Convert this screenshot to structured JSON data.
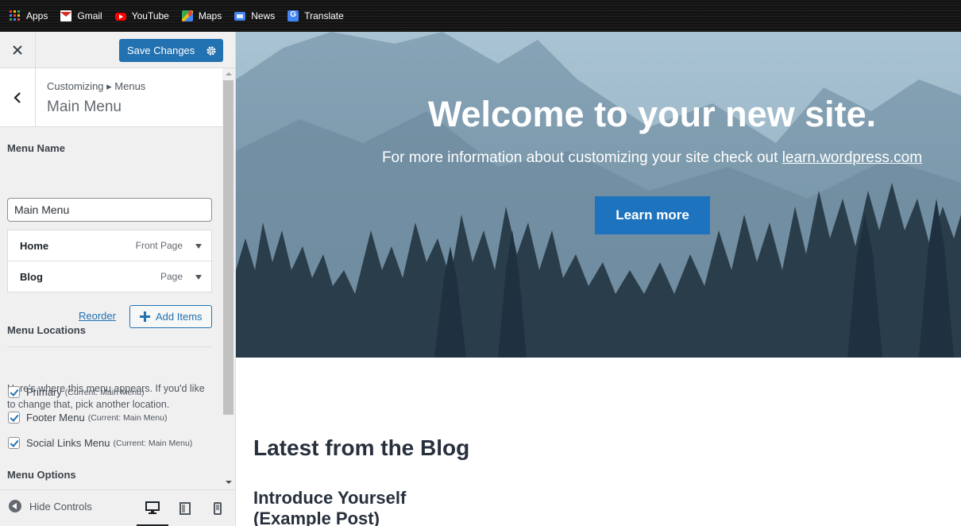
{
  "bookmarks": [
    {
      "label": "Apps",
      "icon": "apps-grid-icon"
    },
    {
      "label": "Gmail",
      "icon": "gmail-icon"
    },
    {
      "label": "YouTube",
      "icon": "youtube-icon"
    },
    {
      "label": "Maps",
      "icon": "maps-icon"
    },
    {
      "label": "News",
      "icon": "news-icon"
    },
    {
      "label": "Translate",
      "icon": "translate-icon"
    }
  ],
  "header": {
    "save_label": "Save Changes"
  },
  "section": {
    "breadcrumb": "Customizing ▸ Menus",
    "title": "Main Menu"
  },
  "menu_name": {
    "label": "Menu Name",
    "value": "Main Menu"
  },
  "menu_items": [
    {
      "title": "Home",
      "type": "Front Page"
    },
    {
      "title": "Blog",
      "type": "Page"
    }
  ],
  "actions": {
    "reorder": "Reorder",
    "add_items": "Add Items"
  },
  "locations": {
    "heading": "Menu Locations",
    "description": "Here's where this menu appears. If you'd like to change that, pick another location.",
    "items": [
      {
        "label": "Primary",
        "note": "(Current: Main Menu)",
        "checked": true
      },
      {
        "label": "Footer Menu",
        "note": "(Current: Main Menu)",
        "checked": true
      },
      {
        "label": "Social Links Menu",
        "note": "(Current: Main Menu)",
        "checked": true
      }
    ]
  },
  "options": {
    "heading": "Menu Options"
  },
  "footer": {
    "hide_controls": "Hide Controls"
  },
  "preview": {
    "hero_title": "Welcome to your new site.",
    "hero_sub": "For more information about customizing your site check out",
    "hero_link": "learn.wordpress.com",
    "learn_more": "Learn more",
    "blog_heading": "Latest from the Blog",
    "post_title": "Introduce Yourself (Example Post)"
  },
  "colors": {
    "accent": "#2271b1",
    "button": "#1e73be"
  }
}
